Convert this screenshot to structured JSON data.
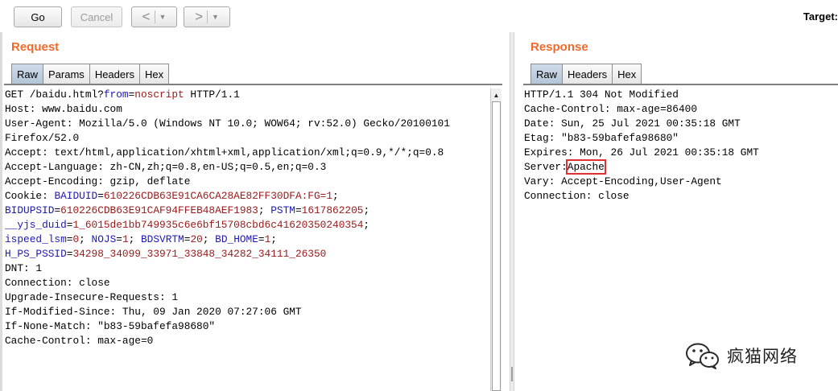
{
  "toolbar": {
    "go_label": "Go",
    "cancel_label": "Cancel",
    "back_glyph": "<",
    "forward_glyph": ">",
    "dropdown_glyph": "▼",
    "target_label": "Target:"
  },
  "request": {
    "title": "Request",
    "tabs": [
      "Raw",
      "Params",
      "Headers",
      "Hex"
    ],
    "active_tab": "Raw",
    "lines": [
      [
        {
          "t": "GET /baidu.html?"
        },
        {
          "t": "from",
          "c": "pn"
        },
        {
          "t": "="
        },
        {
          "t": "noscript",
          "c": "pv"
        },
        {
          "t": " HTTP/1.1"
        }
      ],
      [
        {
          "t": "Host: www.baidu.com"
        }
      ],
      [
        {
          "t": "User-Agent: Mozilla/5.0 (Windows NT 10.0; WOW64; rv:52.0) Gecko/20100101"
        }
      ],
      [
        {
          "t": "Firefox/52.0"
        }
      ],
      [
        {
          "t": "Accept: text/html,application/xhtml+xml,application/xml;q=0.9,*/*;q=0.8"
        }
      ],
      [
        {
          "t": "Accept-Language: zh-CN,zh;q=0.8,en-US;q=0.5,en;q=0.3"
        }
      ],
      [
        {
          "t": "Accept-Encoding: gzip, deflate"
        }
      ],
      [
        {
          "t": "Cookie: "
        },
        {
          "t": "BAIDUID",
          "c": "pn"
        },
        {
          "t": "="
        },
        {
          "t": "610226CDB63E91CA6CA28AE82FF30DFA:FG=1",
          "c": "pv"
        },
        {
          "t": ";"
        }
      ],
      [
        {
          "t": "BIDUPSID",
          "c": "pn"
        },
        {
          "t": "="
        },
        {
          "t": "610226CDB63E91CAF94FFEB48AEF1983",
          "c": "pv"
        },
        {
          "t": "; "
        },
        {
          "t": "PSTM",
          "c": "pn"
        },
        {
          "t": "="
        },
        {
          "t": "1617862205",
          "c": "pv"
        },
        {
          "t": ";"
        }
      ],
      [
        {
          "t": "__yjs_duid",
          "c": "pn"
        },
        {
          "t": "="
        },
        {
          "t": "1_6015de1bb749935c6e6bf15708cbd6c41620350240354",
          "c": "pv"
        },
        {
          "t": ";"
        }
      ],
      [
        {
          "t": "ispeed_lsm",
          "c": "pn"
        },
        {
          "t": "="
        },
        {
          "t": "0",
          "c": "pv"
        },
        {
          "t": "; "
        },
        {
          "t": "NOJS",
          "c": "pn"
        },
        {
          "t": "="
        },
        {
          "t": "1",
          "c": "pv"
        },
        {
          "t": "; "
        },
        {
          "t": "BDSVRTM",
          "c": "pn"
        },
        {
          "t": "="
        },
        {
          "t": "20",
          "c": "pv"
        },
        {
          "t": "; "
        },
        {
          "t": "BD_HOME",
          "c": "pn"
        },
        {
          "t": "="
        },
        {
          "t": "1",
          "c": "pv"
        },
        {
          "t": ";"
        }
      ],
      [
        {
          "t": "H_PS_PSSID",
          "c": "pn"
        },
        {
          "t": "="
        },
        {
          "t": "34298_34099_33971_33848_34282_34111_26350",
          "c": "pv"
        }
      ],
      [
        {
          "t": "DNT: 1"
        }
      ],
      [
        {
          "t": "Connection: close"
        }
      ],
      [
        {
          "t": "Upgrade-Insecure-Requests: 1"
        }
      ],
      [
        {
          "t": "If-Modified-Since: Thu, 09 Jan 2020 07:27:06 GMT"
        }
      ],
      [
        {
          "t": "If-None-Match: \"b83-59bafefa98680\""
        }
      ],
      [
        {
          "t": "Cache-Control: max-age=0"
        }
      ]
    ]
  },
  "response": {
    "title": "Response",
    "tabs": [
      "Raw",
      "Headers",
      "Hex"
    ],
    "active_tab": "Raw",
    "lines": [
      [
        {
          "t": "HTTP/1.1 304 Not Modified"
        }
      ],
      [
        {
          "t": "Cache-Control: max-age=86400"
        }
      ],
      [
        {
          "t": "Date: Sun, 25 Jul 2021 00:35:18 GMT"
        }
      ],
      [
        {
          "t": "Etag: \"b83-59bafefa98680\""
        }
      ],
      [
        {
          "t": "Expires: Mon, 26 Jul 2021 00:35:18 GMT"
        }
      ],
      [
        {
          "t": "Server:"
        },
        {
          "t": "Apache",
          "c": "boxed"
        }
      ],
      [
        {
          "t": "Vary: Accept-Encoding,User-Agent"
        }
      ],
      [
        {
          "t": "Connection: close"
        }
      ]
    ]
  },
  "watermark": {
    "text": "疯猫网络",
    "icon": "wechat-icon"
  },
  "colors": {
    "title_orange": "#f2692c",
    "param_name": "#1d18b2",
    "param_value": "#9a1818",
    "highlight_box": "#e03030"
  }
}
